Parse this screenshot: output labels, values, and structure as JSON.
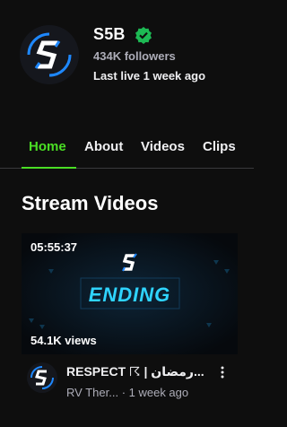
{
  "channel": {
    "name": "S5B",
    "followers": "434K followers",
    "last_live": "Last live 1 week ago",
    "verified_color": "#1db954",
    "avatar_logo": "s5b-logo-icon"
  },
  "tabs": [
    {
      "label": "Home",
      "active": true
    },
    {
      "label": "About",
      "active": false
    },
    {
      "label": "Videos",
      "active": false
    },
    {
      "label": "Clips",
      "active": false
    }
  ],
  "section": {
    "title": "Stream Videos"
  },
  "video": {
    "duration": "05:55:37",
    "thumbnail_text": "ENDING",
    "views": "54.1K views",
    "title": "RESPECT ☈ | رمضان...",
    "category": "RV Ther...",
    "age": "· 1 week ago"
  },
  "colors": {
    "accent": "#4ade24",
    "background": "#0e0e0e",
    "muted": "#adadb8",
    "thumbnail_glow": "#2fd4ff"
  }
}
